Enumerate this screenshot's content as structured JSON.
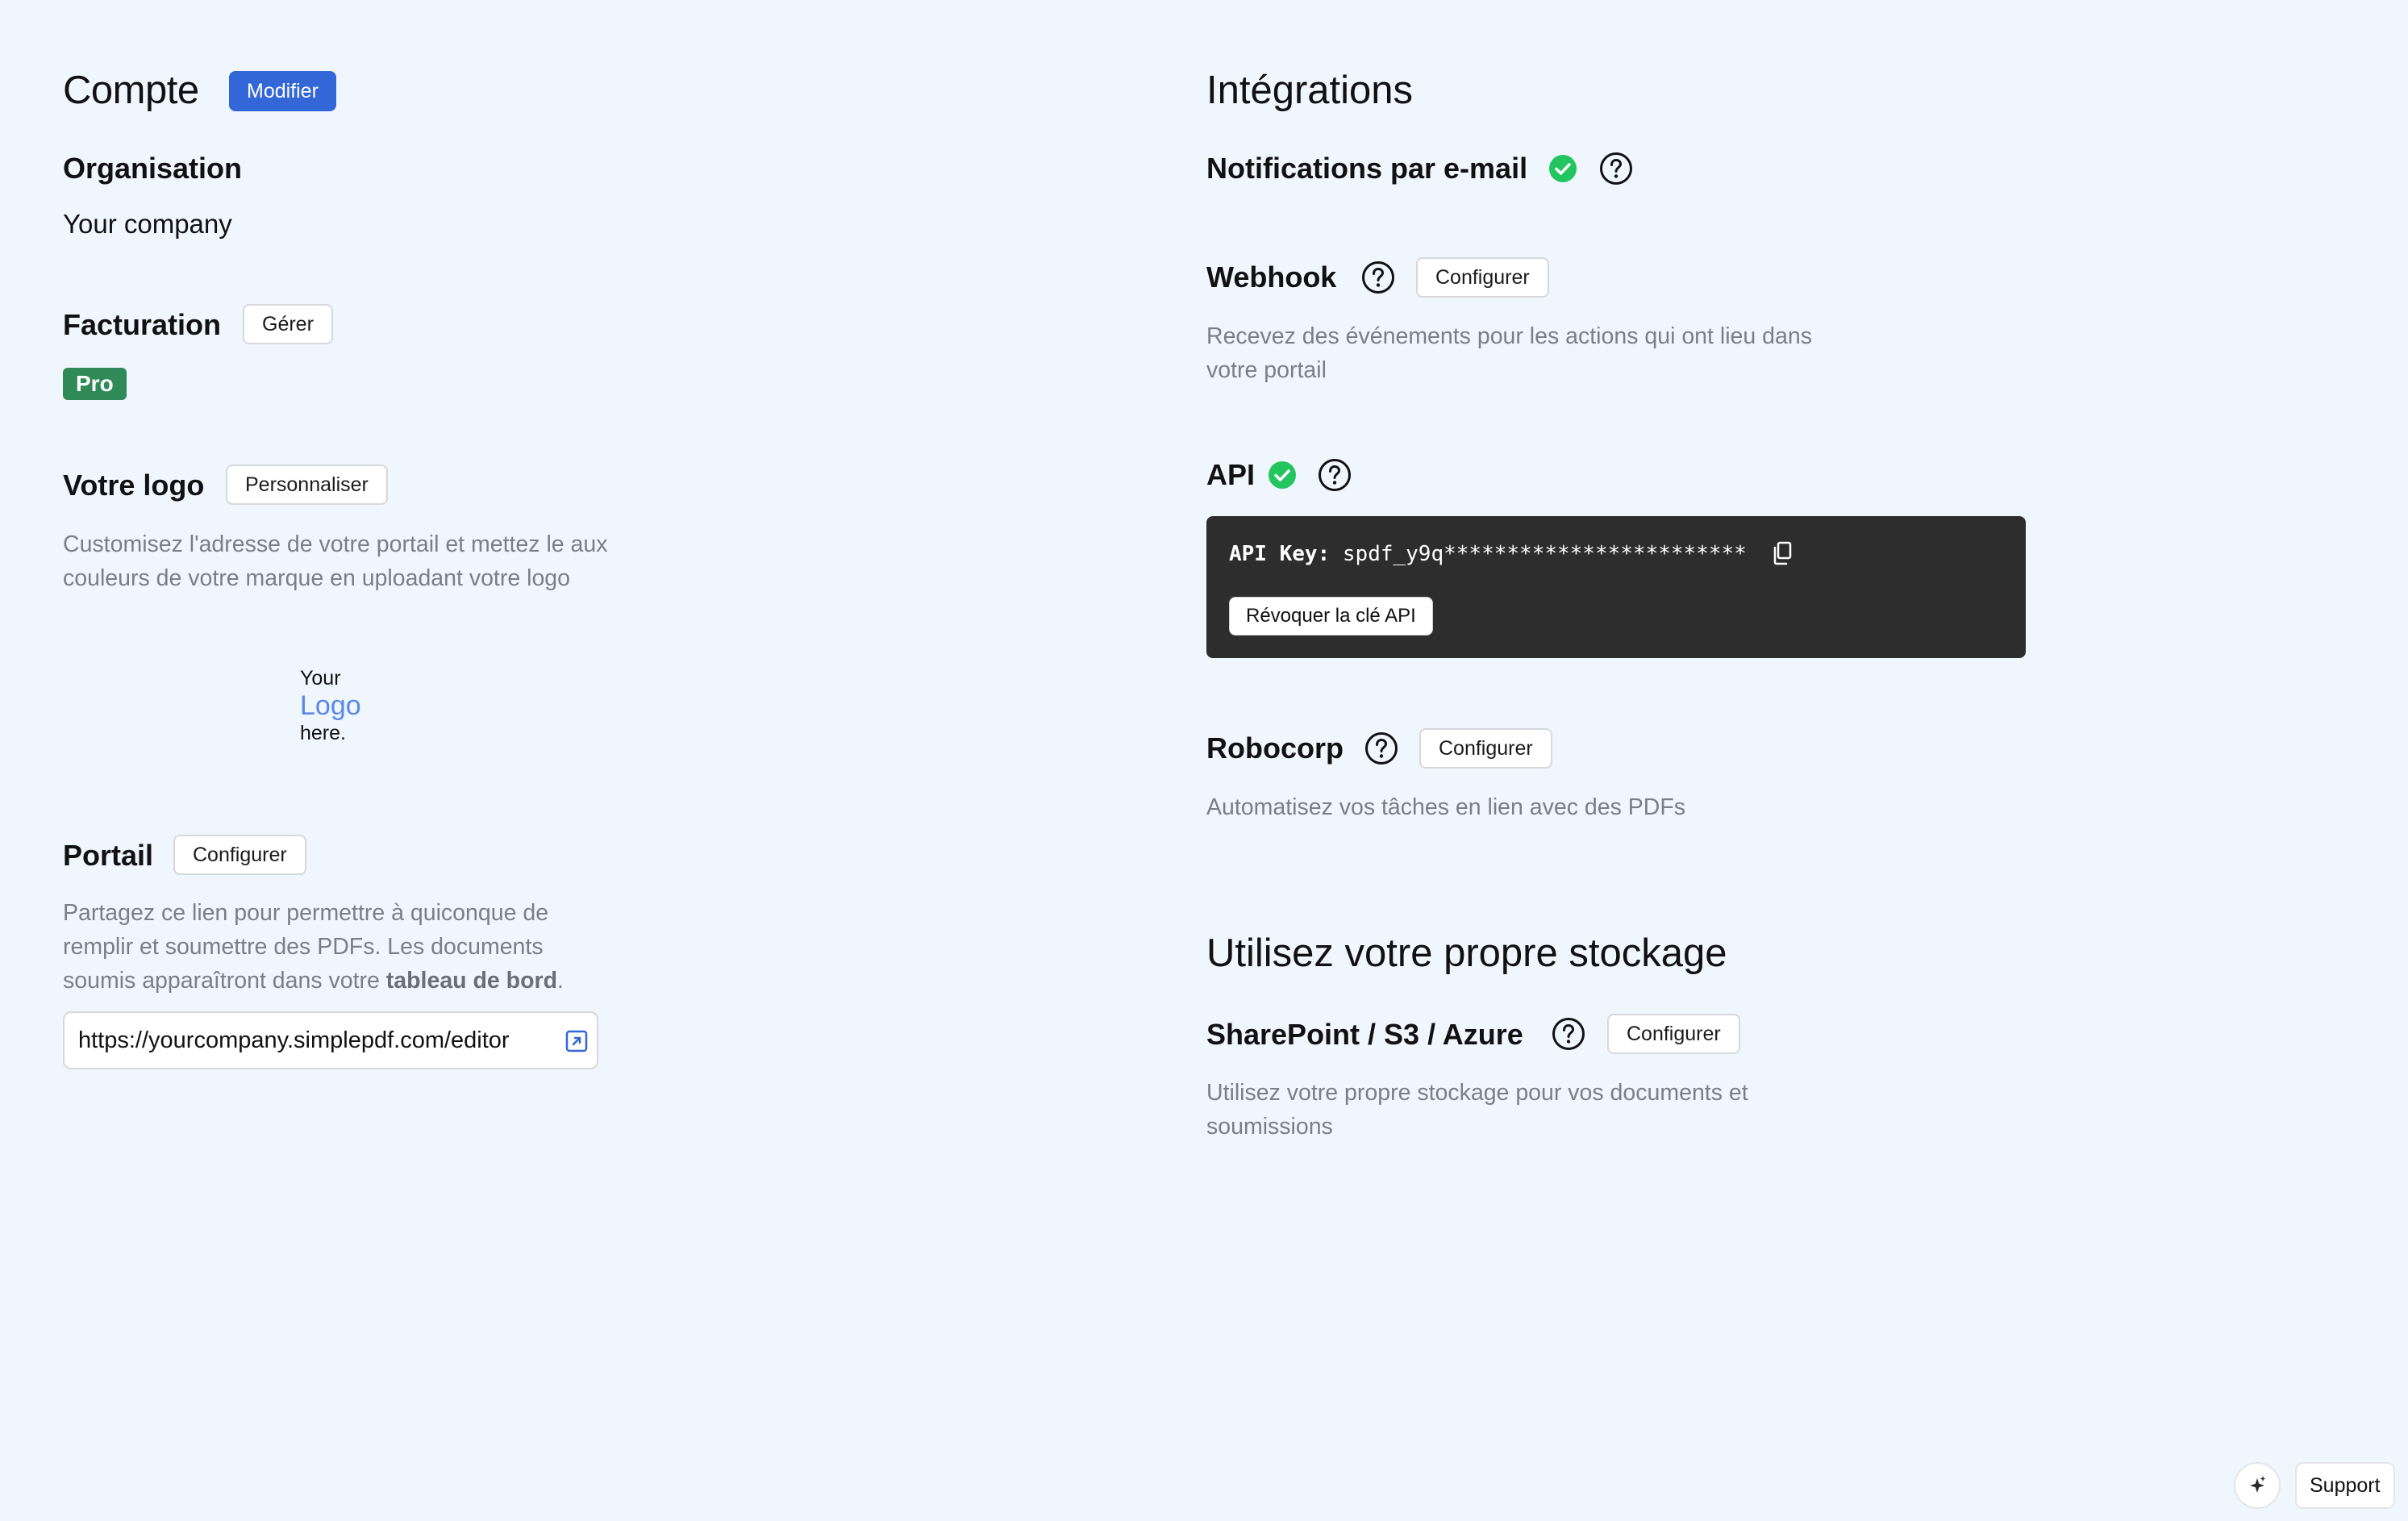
{
  "account": {
    "title": "Compte",
    "edit_label": "Modifier",
    "organisation": {
      "title": "Organisation",
      "value": "Your company"
    },
    "billing": {
      "title": "Facturation",
      "manage_label": "Gérer",
      "plan_badge": "Pro"
    },
    "logo": {
      "title": "Votre logo",
      "customize_label": "Personnaliser",
      "description": "Customisez l'adresse de votre portail et mettez le aux couleurs de votre marque en uploadant votre logo",
      "placeholder_line1": "Your",
      "placeholder_line2": "Logo",
      "placeholder_line3": "here."
    },
    "portal": {
      "title": "Portail",
      "configure_label": "Configurer",
      "description_start": "Partagez ce lien pour permettre à quiconque de remplir et soumettre des PDFs. Les documents soumis apparaîtront dans votre ",
      "description_bold": "tableau de bord",
      "description_end": ".",
      "url": "https://yourcompany.simplepdf.com/editor"
    }
  },
  "integrations": {
    "title": "Intégrations",
    "email_notifications": {
      "title": "Notifications par e-mail"
    },
    "webhook": {
      "title": "Webhook",
      "configure_label": "Configurer",
      "description": "Recevez des événements pour les actions qui ont lieu dans votre portail"
    },
    "api": {
      "title": "API",
      "key_label": "API Key:",
      "key_value": "spdf_y9q************************",
      "revoke_label": "Révoquer la clé API"
    },
    "robocorp": {
      "title": "Robocorp",
      "configure_label": "Configurer",
      "description": "Automatisez vos tâches en lien avec des PDFs"
    }
  },
  "storage": {
    "title": "Utilisez votre propre stockage",
    "provider": {
      "title": "SharePoint / S3 / Azure",
      "configure_label": "Configurer",
      "description": "Utilisez votre propre stockage pour vos documents et soumissions"
    }
  },
  "footer": {
    "support_label": "Support"
  },
  "colors": {
    "background": "#eff6fe",
    "primary": "#3366d6",
    "success": "#22c55e",
    "pro_badge": "#2f8a57",
    "api_box": "#2d2d2d"
  },
  "icons": {
    "check": "check-circle-icon",
    "help": "help-circle-icon",
    "external_link": "external-link-icon",
    "copy": "copy-icon",
    "sparkle": "sparkle-icon"
  }
}
